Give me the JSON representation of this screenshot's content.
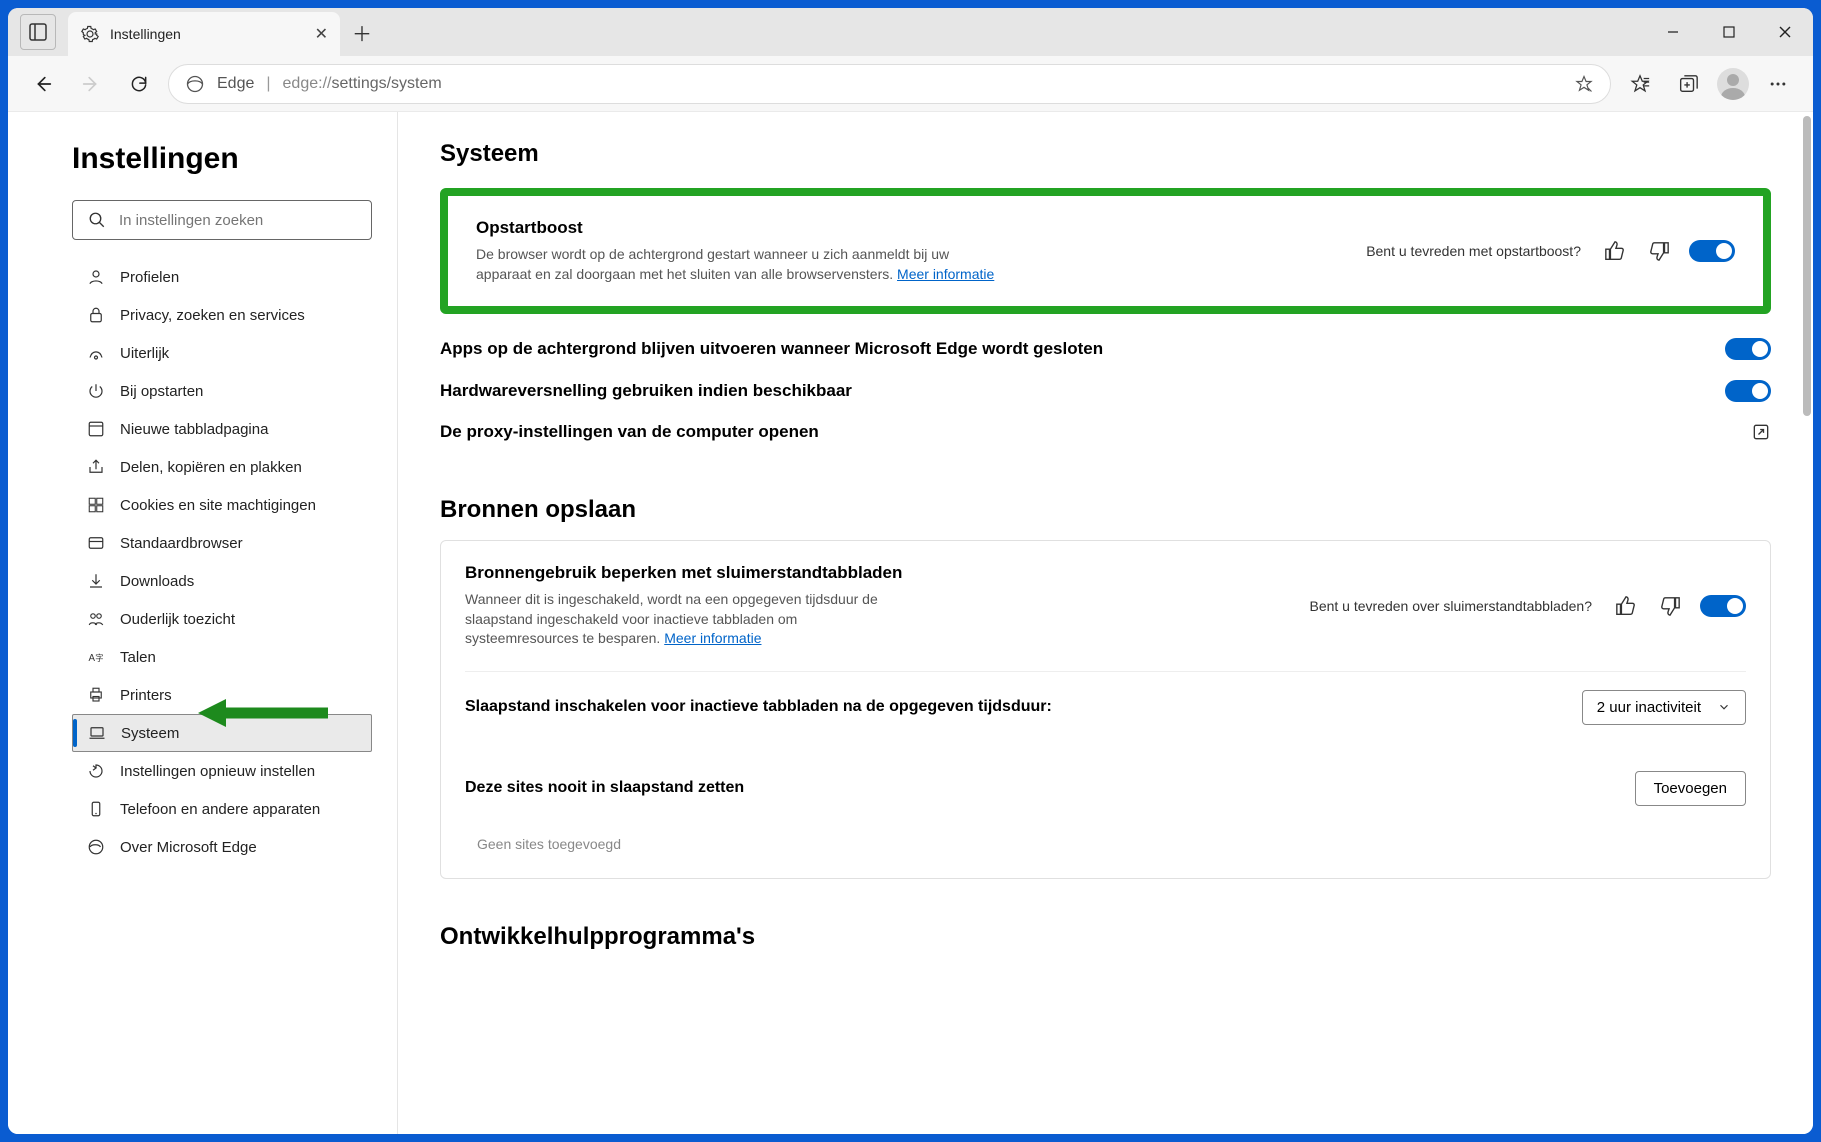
{
  "tab": {
    "title": "Instellingen"
  },
  "address": {
    "label": "Edge",
    "url_prefix": "edge://",
    "url_rest": "settings/system"
  },
  "sidebar": {
    "heading": "Instellingen",
    "search_placeholder": "In instellingen zoeken",
    "items": [
      {
        "label": "Profielen"
      },
      {
        "label": "Privacy, zoeken en services"
      },
      {
        "label": "Uiterlijk"
      },
      {
        "label": "Bij opstarten"
      },
      {
        "label": "Nieuwe tabbladpagina"
      },
      {
        "label": "Delen, kopiëren en plakken"
      },
      {
        "label": "Cookies en site machtigingen"
      },
      {
        "label": "Standaardbrowser"
      },
      {
        "label": "Downloads"
      },
      {
        "label": "Ouderlijk toezicht"
      },
      {
        "label": "Talen"
      },
      {
        "label": "Printers"
      },
      {
        "label": "Systeem"
      },
      {
        "label": "Instellingen opnieuw instellen"
      },
      {
        "label": "Telefoon en andere apparaten"
      },
      {
        "label": "Over Microsoft Edge"
      }
    ]
  },
  "main": {
    "system_heading": "Systeem",
    "startup_boost": {
      "title": "Opstartboost",
      "desc": "De browser wordt op de achtergrond gestart wanneer u zich aanmeldt bij uw apparaat en zal doorgaan met het sluiten van alle browservensters. ",
      "link": "Meer informatie",
      "feedback_q": "Bent u tevreden met opstartboost?"
    },
    "bg_apps": "Apps op de achtergrond blijven uitvoeren wanneer Microsoft Edge wordt gesloten",
    "hw_accel": "Hardwareversnelling gebruiken indien beschikbaar",
    "proxy": "De proxy-instellingen van de computer openen",
    "resources_heading": "Bronnen opslaan",
    "sleep_tabs": {
      "title": "Bronnengebruik beperken met sluimerstandtabbladen",
      "desc": "Wanneer dit is ingeschakeld, wordt na een opgegeven tijdsduur de slaapstand ingeschakeld voor inactieve tabbladen om systeemresources te besparen. ",
      "link": "Meer informatie",
      "feedback_q": "Bent u tevreden over sluimerstandtabbladen?"
    },
    "sleep_timeout_label": "Slaapstand inschakelen voor inactieve tabbladen na de opgegeven tijdsduur:",
    "sleep_timeout_value": "2 uur inactiviteit",
    "never_sleep_label": "Deze sites nooit in slaapstand zetten",
    "add_btn": "Toevoegen",
    "no_sites": "Geen sites toegevoegd",
    "dev_heading": "Ontwikkelhulpprogramma's"
  }
}
